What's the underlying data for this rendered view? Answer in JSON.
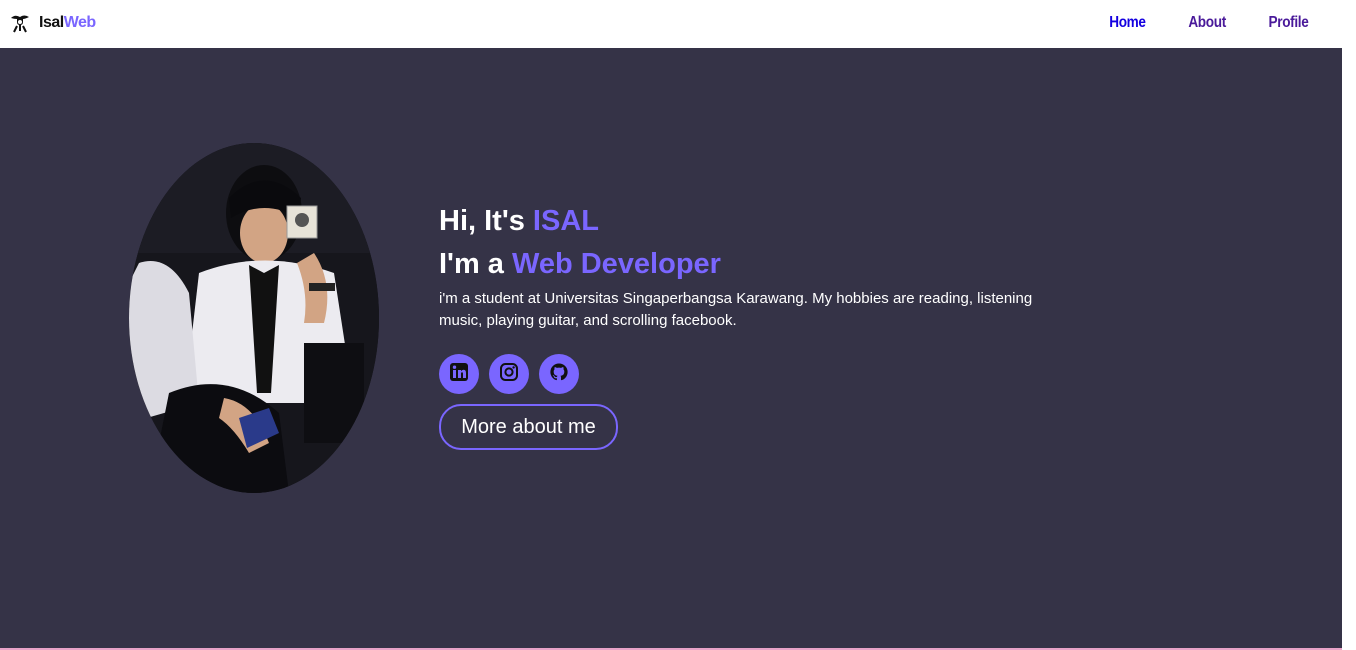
{
  "brand": {
    "part1": "Isal",
    "part2": "Web",
    "icon": "logo-icon"
  },
  "nav": {
    "home": "Home",
    "about": "About",
    "profile": "Profile"
  },
  "hero": {
    "greeting_prefix": "Hi, It's ",
    "greeting_name": "ISAL",
    "role_prefix": "I'm a ",
    "role_title": "Web Developer",
    "bio": "i'm a student at Universitas Singaperbangsa Karawang. My hobbies are reading, listening music, playing guitar, and scrolling facebook.",
    "more_button": "More about me",
    "photo": "profile-photo"
  },
  "socials": [
    {
      "icon": "linkedin-icon"
    },
    {
      "icon": "instagram-icon"
    },
    {
      "icon": "github-icon"
    }
  ],
  "colors": {
    "accent": "#7a66ff",
    "hero_bg": "#353347",
    "nav_home": "#1400e0",
    "nav_other": "#4a1a9a"
  }
}
